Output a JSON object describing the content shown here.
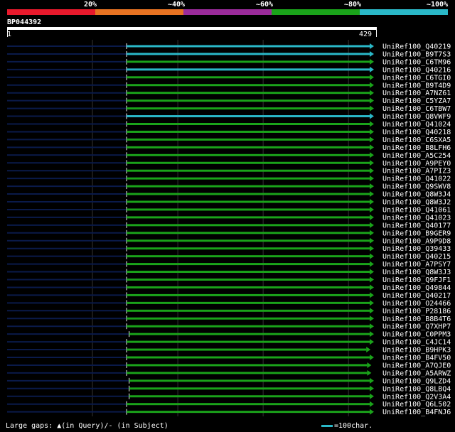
{
  "coverage_legend": [
    {
      "label": "",
      "color": "#e8192c"
    },
    {
      "label": "20%",
      "color": "#e87322"
    },
    {
      "label": "~40%",
      "color": "#9b2b9b"
    },
    {
      "label": "~60%",
      "color": "#1aa31a"
    },
    {
      "label": "~80%",
      "color": "#2ab8c8"
    },
    {
      "label": "~100%",
      "color": ""
    }
  ],
  "query": {
    "name": "BP044392",
    "start": "1",
    "end": "429",
    "length": 429
  },
  "colors": {
    "green": "#1aa31a",
    "cyan": "#2ab8c8",
    "dark": "#0a1a4a",
    "grid": "#333333"
  },
  "hits": [
    {
      "name": "UniRef100_Q40219",
      "color": "cyan",
      "start": 140,
      "end": 429
    },
    {
      "name": "UniRef100_B9T7S3",
      "color": "cyan",
      "start": 140,
      "end": 429
    },
    {
      "name": "UniRef100_C6TM96",
      "color": "green",
      "start": 140,
      "end": 429
    },
    {
      "name": "UniRef100_Q40216",
      "color": "cyan",
      "start": 140,
      "end": 429
    },
    {
      "name": "UniRef100_C6TGI0",
      "color": "green",
      "start": 140,
      "end": 429
    },
    {
      "name": "UniRef100_B9T4D9",
      "color": "green",
      "start": 140,
      "end": 429
    },
    {
      "name": "UniRef100_A7NZ61",
      "color": "green",
      "start": 140,
      "end": 429
    },
    {
      "name": "UniRef100_C5YZA7",
      "color": "green",
      "start": 140,
      "end": 429
    },
    {
      "name": "UniRef100_C6TBW7",
      "color": "green",
      "start": 140,
      "end": 429
    },
    {
      "name": "UniRef100_Q8VWF9",
      "color": "cyan",
      "start": 140,
      "end": 429
    },
    {
      "name": "UniRef100_Q41024",
      "color": "green",
      "start": 140,
      "end": 429
    },
    {
      "name": "UniRef100_Q40218",
      "color": "green",
      "start": 140,
      "end": 429
    },
    {
      "name": "UniRef100_C6SXA5",
      "color": "green",
      "start": 140,
      "end": 429
    },
    {
      "name": "UniRef100_B8LFH6",
      "color": "green",
      "start": 140,
      "end": 429
    },
    {
      "name": "UniRef100_A5C254",
      "color": "green",
      "start": 140,
      "end": 429
    },
    {
      "name": "UniRef100_A9PEY0",
      "color": "green",
      "start": 140,
      "end": 429
    },
    {
      "name": "UniRef100_A7PIZ3",
      "color": "green",
      "start": 140,
      "end": 429
    },
    {
      "name": "UniRef100_Q41022",
      "color": "green",
      "start": 140,
      "end": 429
    },
    {
      "name": "UniRef100_Q9SWV8",
      "color": "green",
      "start": 140,
      "end": 429
    },
    {
      "name": "UniRef100_Q8W3J4",
      "color": "green",
      "start": 140,
      "end": 429
    },
    {
      "name": "UniRef100_Q8W3J2",
      "color": "green",
      "start": 140,
      "end": 429
    },
    {
      "name": "UniRef100_Q41061",
      "color": "green",
      "start": 140,
      "end": 429
    },
    {
      "name": "UniRef100_Q41023",
      "color": "green",
      "start": 140,
      "end": 429
    },
    {
      "name": "UniRef100_Q40177",
      "color": "green",
      "start": 140,
      "end": 429
    },
    {
      "name": "UniRef100_B9GER9",
      "color": "green",
      "start": 140,
      "end": 429
    },
    {
      "name": "UniRef100_A9P9D8",
      "color": "green",
      "start": 140,
      "end": 429
    },
    {
      "name": "UniRef100_Q39433",
      "color": "green",
      "start": 140,
      "end": 429
    },
    {
      "name": "UniRef100_Q40215",
      "color": "green",
      "start": 140,
      "end": 429
    },
    {
      "name": "UniRef100_A7PSY7",
      "color": "green",
      "start": 140,
      "end": 429
    },
    {
      "name": "UniRef100_Q8W3J3",
      "color": "green",
      "start": 140,
      "end": 429
    },
    {
      "name": "UniRef100_Q9FJF1",
      "color": "green",
      "start": 140,
      "end": 429
    },
    {
      "name": "UniRef100_Q49844",
      "color": "green",
      "start": 140,
      "end": 429
    },
    {
      "name": "UniRef100_Q40217",
      "color": "green",
      "start": 140,
      "end": 429
    },
    {
      "name": "UniRef100_O24466",
      "color": "green",
      "start": 140,
      "end": 429
    },
    {
      "name": "UniRef100_P28186",
      "color": "green",
      "start": 140,
      "end": 429
    },
    {
      "name": "UniRef100_B8B4T6",
      "color": "green",
      "start": 140,
      "end": 429
    },
    {
      "name": "UniRef100_Q7XHP7",
      "color": "green",
      "start": 140,
      "end": 429
    },
    {
      "name": "UniRef100_C0PPM3",
      "color": "green",
      "start": 143,
      "end": 429
    },
    {
      "name": "UniRef100_C4JC14",
      "color": "green",
      "start": 140,
      "end": 429
    },
    {
      "name": "UniRef100_B9HPK3",
      "color": "green",
      "start": 140,
      "end": 425
    },
    {
      "name": "UniRef100_B4FV50",
      "color": "green",
      "start": 140,
      "end": 429
    },
    {
      "name": "UniRef100_A7QJE0",
      "color": "green",
      "start": 140,
      "end": 426
    },
    {
      "name": "UniRef100_A5ARWZ",
      "color": "green",
      "start": 140,
      "end": 426
    },
    {
      "name": "UniRef100_Q9LZD4",
      "color": "green",
      "start": 143,
      "end": 429
    },
    {
      "name": "UniRef100_Q8LBQ4",
      "color": "green",
      "start": 143,
      "end": 429
    },
    {
      "name": "UniRef100_Q2V3A4",
      "color": "green",
      "start": 143,
      "end": 429
    },
    {
      "name": "UniRef100_Q6L502",
      "color": "green",
      "start": 140,
      "end": 429
    },
    {
      "name": "UniRef100_B4FNJ6",
      "color": "green",
      "start": 140,
      "end": 429
    }
  ],
  "footer": {
    "gaps_text": "Large gaps: ▲(in Query)/- (in Subject)",
    "scale_text": "=100char."
  }
}
